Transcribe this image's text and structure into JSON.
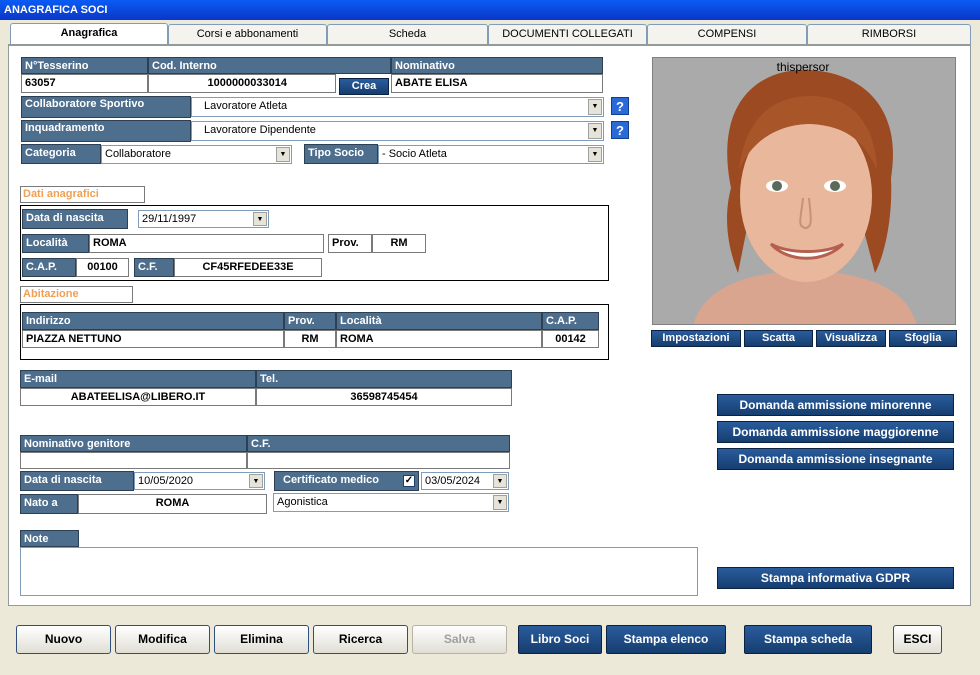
{
  "window": {
    "title": "ANAGRAFICA SOCI"
  },
  "tabs": [
    {
      "label": "Anagrafica"
    },
    {
      "label": "Corsi e abbonamenti"
    },
    {
      "label": "Scheda"
    },
    {
      "label": "DOCUMENTI COLLEGATI"
    },
    {
      "label": "COMPENSI"
    },
    {
      "label": "RIMBORSI"
    }
  ],
  "socio": {
    "tessera_label": "N°Tesserino",
    "tessera": "63057",
    "cod_label": "Cod. Interno",
    "cod": "1000000033014",
    "crea_label": "Crea",
    "nominativo_label": "Nominativo",
    "nominativo": "ABATE ELISA",
    "collab_label": "Collaboratore Sportivo",
    "collab": "Lavoratore Atleta",
    "inquad_label": "Inquadramento",
    "inquad": "Lavoratore Dipendente",
    "categoria_label": "Categoria",
    "categoria": "Collaboratore",
    "tipo_label": "Tipo Socio",
    "tipo": "- Socio Atleta",
    "help": "?"
  },
  "anagrafici": {
    "title": "Dati anagrafici",
    "nascita_label": "Data di nascita",
    "nascita": "29/11/1997",
    "localita_label": "Località",
    "localita": "ROMA",
    "prov_label": "Prov.",
    "prov": "RM",
    "cap_label": "C.A.P.",
    "cap": "00100",
    "cf_label": "C.F.",
    "cf": "CF45RFEDEE33E"
  },
  "abitazione": {
    "title": "Abitazione",
    "indirizzo_label": "Indirizzo",
    "indirizzo": "PIAZZA NETTUNO",
    "prov_label": "Prov.",
    "prov": "RM",
    "localita_label": "Località",
    "localita": "ROMA",
    "cap_label": "C.A.P.",
    "cap": "00142"
  },
  "contatti": {
    "email_label": "E-mail",
    "email": "ABATEELISA@LIBERO.IT",
    "tel_label": "Tel.",
    "tel": "36598745454"
  },
  "genitore": {
    "nominativo_label": "Nominativo genitore",
    "nominativo": "",
    "cf_label": "C.F.",
    "cf": "",
    "nascita_label": "Data di nascita",
    "nascita": "10/05/2020",
    "cert_label": "Certificato medico",
    "cert_checked": "✓",
    "cert_date": "03/05/2024",
    "nato_label": "Nato a",
    "nato": "ROMA",
    "cert_tipo": "Agonistica"
  },
  "note": {
    "label": "Note",
    "value": ""
  },
  "photo": {
    "caption": "thispersor",
    "buttons": [
      "Impostazioni",
      "Scatta",
      "Visualizza",
      "Sfoglia"
    ]
  },
  "side_buttons": [
    "Domanda ammissione minorenne",
    "Domanda ammissione maggiorenne",
    "Domanda ammissione insegnante",
    "Stampa informativa GDPR"
  ],
  "footer": {
    "nuovo": "Nuovo",
    "modifica": "Modifica",
    "elimina": "Elimina",
    "ricerca": "Ricerca",
    "salva": "Salva",
    "libro": "Libro Soci",
    "stampa_elenco": "Stampa elenco",
    "stampa_scheda": "Stampa scheda",
    "esci": "ESCI"
  },
  "arrow": "▼"
}
